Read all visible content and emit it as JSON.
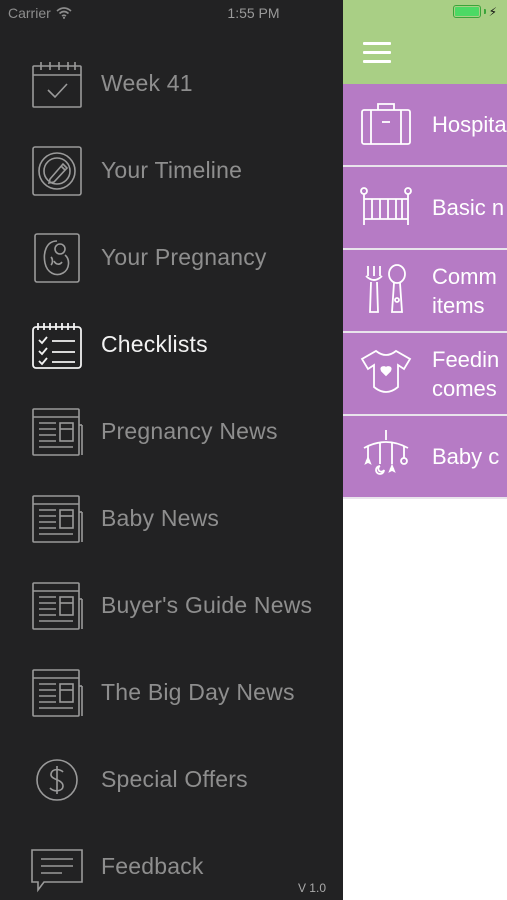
{
  "status_bar": {
    "carrier": "Carrier",
    "time": "1:55 PM"
  },
  "menu": {
    "items": [
      {
        "label": "Week 41",
        "icon": "calendar-check-icon",
        "active": false
      },
      {
        "label": "Your Timeline",
        "icon": "clock-pencil-icon",
        "active": false
      },
      {
        "label": "Your Pregnancy",
        "icon": "fetus-icon",
        "active": false
      },
      {
        "label": "Checklists",
        "icon": "checklist-icon",
        "active": true
      },
      {
        "label": "Pregnancy News",
        "icon": "newspaper-icon",
        "active": false
      },
      {
        "label": "Baby News",
        "icon": "newspaper-icon",
        "active": false
      },
      {
        "label": "Buyer's Guide News",
        "icon": "newspaper-icon",
        "active": false
      },
      {
        "label": "The Big Day News",
        "icon": "newspaper-icon",
        "active": false
      },
      {
        "label": "Special Offers",
        "icon": "dollar-coin-icon",
        "active": false
      },
      {
        "label": "Feedback",
        "icon": "feedback-speech-icon",
        "active": false
      }
    ],
    "version": "V 1.0"
  },
  "main": {
    "checklists": [
      {
        "label": "Hospita",
        "icon": "suitcase-icon"
      },
      {
        "label": "Basic n",
        "icon": "crib-icon"
      },
      {
        "label": "Comm\nitems",
        "icon": "fork-spoon-icon"
      },
      {
        "label": "Feedin\ncomes",
        "icon": "onesie-icon"
      },
      {
        "label": "Baby c",
        "icon": "baby-mobile-icon"
      }
    ]
  },
  "colors": {
    "drawer_bg": "#222223",
    "topbar_green": "#a9cf85",
    "row_purple": "#b67bc5",
    "battery_green": "#4cd964"
  }
}
